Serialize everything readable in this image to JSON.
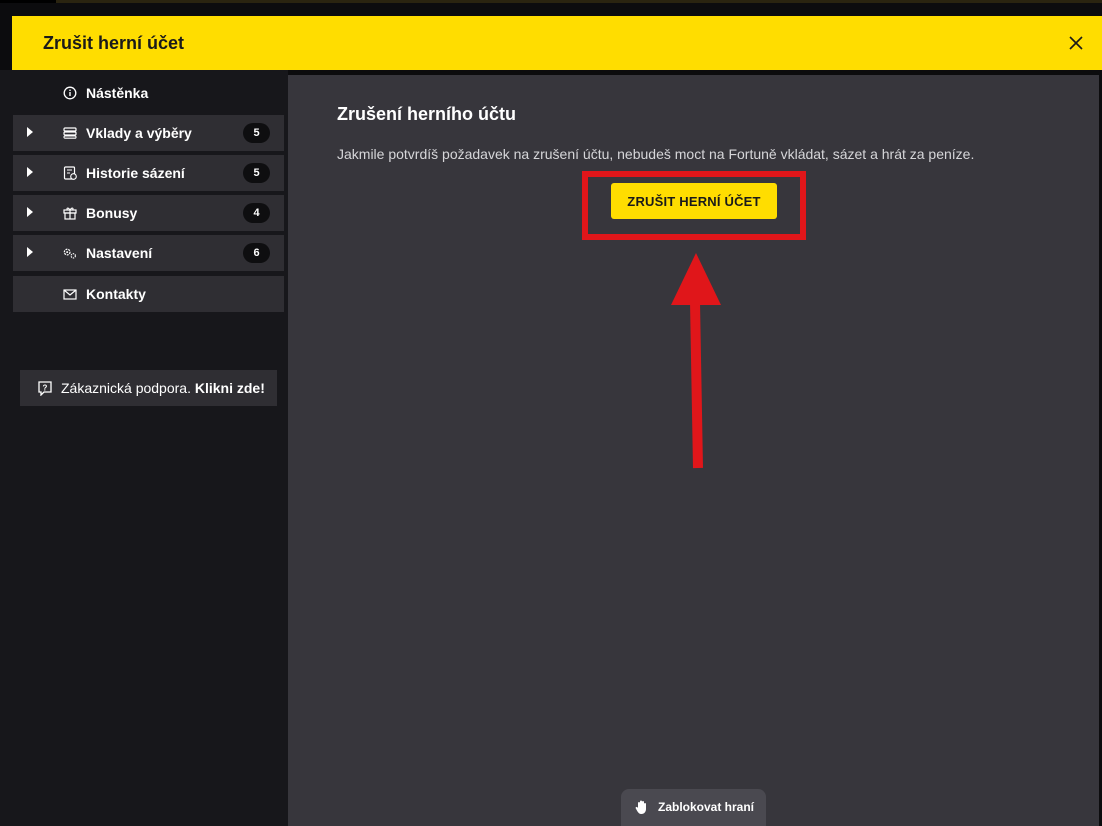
{
  "header": {
    "title": "Zrušit herní účet",
    "close_icon": "close-icon",
    "color": "#ffdd00"
  },
  "sidebar": {
    "items": [
      {
        "label": "Nástěnka",
        "icon": "info-icon",
        "badge": null,
        "expandable": false
      },
      {
        "label": "Vklady a výběry",
        "icon": "wallet-icon",
        "badge": "5",
        "expandable": true
      },
      {
        "label": "Historie sázení",
        "icon": "history-icon",
        "badge": "5",
        "expandable": true
      },
      {
        "label": "Bonusy",
        "icon": "gift-icon",
        "badge": "4",
        "expandable": true
      },
      {
        "label": "Nastavení",
        "icon": "gears-icon",
        "badge": "6",
        "expandable": true
      },
      {
        "label": "Kontakty",
        "icon": "mail-icon",
        "badge": null,
        "expandable": false
      }
    ],
    "support": {
      "text": "Zákaznická podpora. ",
      "link": "Klikni zde!",
      "icon": "question-icon"
    }
  },
  "main": {
    "heading": "Zrušení herního účtu",
    "description": "Jakmile potvrdíš požadavek na zrušení účtu, nebudeš moct na Fortuně vkládat, sázet a hrát za peníze.",
    "cancel_button": "ZRUŠIT HERNÍ ÚČET",
    "annotation_color": "#e0161a"
  },
  "footer": {
    "block_button": "Zablokovat hraní",
    "block_icon": "hand-icon"
  }
}
